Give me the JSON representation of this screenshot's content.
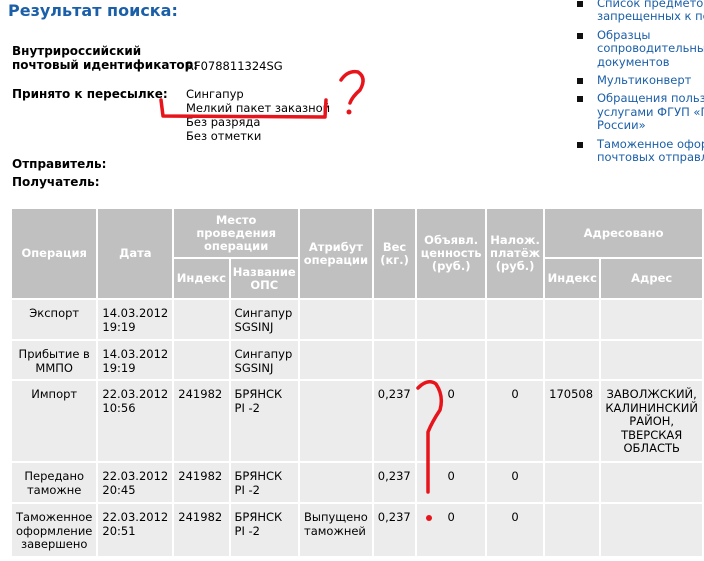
{
  "header": {
    "title": "Результат поиска:"
  },
  "info": {
    "id_label_line1": "Внутрироссийский",
    "id_label_line2": "почтовый идентификатор:",
    "id_value": "RF078811324SG",
    "accepted_label": "Принято к пересылке:",
    "accepted_values": [
      "Сингапур",
      "Мелкий пакет заказной",
      "Без разряда",
      "Без отметки"
    ],
    "sender_label": "Отправитель:",
    "recipient_label": "Получатель:"
  },
  "links": [
    {
      "line1": "Список предметов",
      "line2": "запрещенных к пер"
    },
    {
      "line1": "Образцы",
      "line2": "сопроводительных",
      "line3": "документов"
    },
    {
      "line1": "Мультиконверт"
    },
    {
      "line1": "Обращения пользо",
      "line2": "услугами ФГУП «По",
      "line3": "России»"
    },
    {
      "line1": "Таможенное офор",
      "line2": "почтовых отправле"
    }
  ],
  "table": {
    "headers": {
      "operation": "Операция",
      "date": "Дата",
      "place": "Место проведения операции",
      "index": "Индекс",
      "ops_name": "Название ОПС",
      "attribute": "Атрибут операции",
      "weight": "Вес (кг.)",
      "declared": "Объявл. ценность (руб.)",
      "cod": "Налож. платёж (руб.)",
      "addressed": "Адресовано",
      "addr_index": "Индекс",
      "address": "Адрес"
    },
    "rows": [
      {
        "operation": "Экспорт",
        "date": "14.03.2012 19:19",
        "index": "",
        "ops_name": "Сингапур SGSINJ",
        "attribute": "",
        "weight": "",
        "declared": "",
        "cod": "",
        "addr_index": "",
        "address": ""
      },
      {
        "operation": "Прибытие в ММПО",
        "date": "14.03.2012 19:19",
        "index": "",
        "ops_name": "Сингапур SGSINJ",
        "attribute": "",
        "weight": "",
        "declared": "",
        "cod": "",
        "addr_index": "",
        "address": ""
      },
      {
        "operation": "Импорт",
        "date": "22.03.2012 10:56",
        "index": "241982",
        "ops_name": "БРЯНСК PI -2",
        "attribute": "",
        "weight": "0,237",
        "declared": "0",
        "cod": "0",
        "addr_index": "170508",
        "address": "ЗАВОЛЖСКИЙ, КАЛИНИНСКИЙ РАЙОН, ТВЕРСКАЯ ОБЛАСТЬ"
      },
      {
        "operation": "Передано таможне",
        "date": "22.03.2012 20:45",
        "index": "241982",
        "ops_name": "БРЯНСК PI -2",
        "attribute": "",
        "weight": "0,237",
        "declared": "0",
        "cod": "0",
        "addr_index": "",
        "address": ""
      },
      {
        "operation": "Таможенное оформление завершено",
        "date": "22.03.2012 20:51",
        "index": "241982",
        "ops_name": "БРЯНСК PI -2",
        "attribute": "Выпущено таможней",
        "weight": "0,237",
        "declared": "0",
        "cod": "0",
        "addr_index": "",
        "address": ""
      }
    ]
  },
  "colors": {
    "title": "#1b5fa8",
    "link": "#1b5fa8",
    "header_bg": "#c0c0c0",
    "cell_bg": "#ececec",
    "annotation": "#e8141b"
  }
}
